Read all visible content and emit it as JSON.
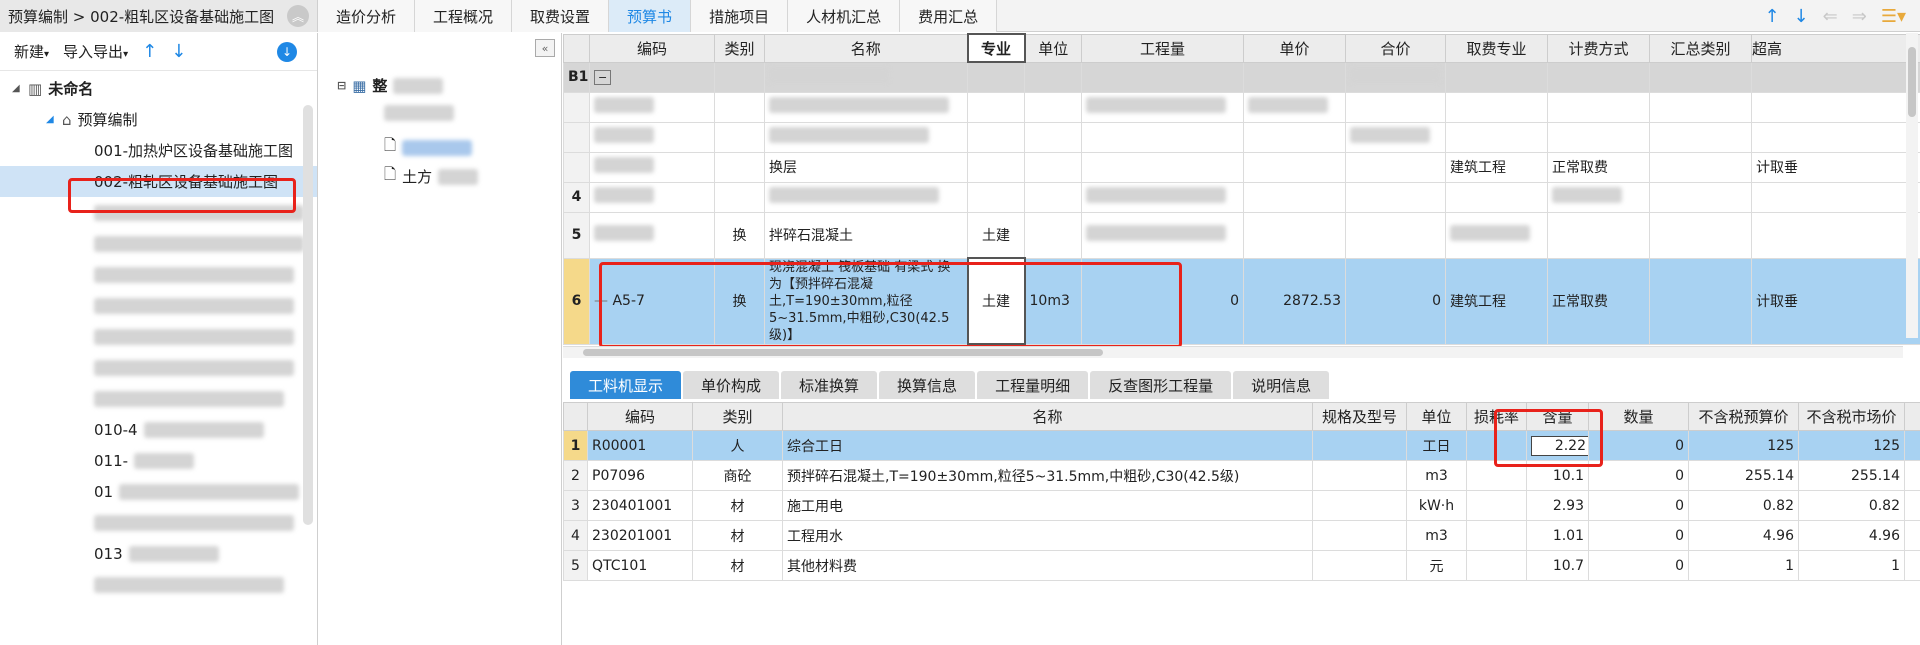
{
  "breadcrumb": "预算编制 > 002-粗轧区设备基础施工图",
  "tabs": [
    {
      "label": "造价分析"
    },
    {
      "label": "工程概况"
    },
    {
      "label": "取费设置"
    },
    {
      "label": "预算书"
    },
    {
      "label": "措施项目"
    },
    {
      "label": "人材机汇总"
    },
    {
      "label": "费用汇总"
    }
  ],
  "active_tab": "预算书",
  "left_toolbar": {
    "new_label": "新建",
    "import_label": "导入导出"
  },
  "tree": {
    "root_label": "未命名",
    "group_label": "预算编制",
    "items": [
      {
        "label": "001-加热炉区设备基础施工图"
      },
      {
        "label": "002-粗轧区设备基础施工图"
      },
      {
        "label": "010-4"
      },
      {
        "label": "011-"
      },
      {
        "label": "01"
      },
      {
        "label": "013"
      }
    ]
  },
  "mid_tree": {
    "root_label": "整",
    "leaf_label": "土方"
  },
  "upper_grid": {
    "columns": [
      "编码",
      "类别",
      "名称",
      "专业",
      "单位",
      "工程量",
      "单价",
      "合价",
      "取费专业",
      "计费方式",
      "汇总类别",
      "超高"
    ],
    "rows": [
      {
        "idx": "B1",
        "code": "",
        "type": "",
        "name": "",
        "spec": "",
        "unit": "",
        "qty": "",
        "price": "",
        "total": "",
        "fee_major": "",
        "fee_mode": "",
        "sum_type": "",
        "extra": ""
      },
      {
        "idx": "",
        "code": "",
        "type": "",
        "name": "",
        "spec": "",
        "unit": "",
        "qty": "",
        "price": "",
        "total": "",
        "fee_major": "",
        "fee_mode": "",
        "sum_type": "",
        "extra": ""
      },
      {
        "idx": "",
        "code": "",
        "type": "",
        "name": "",
        "spec": "",
        "unit": "",
        "qty": "",
        "price": "",
        "total": "",
        "fee_major": "",
        "fee_mode": "",
        "sum_type": "",
        "extra": ""
      },
      {
        "idx": "",
        "code": "",
        "type": "",
        "name": "换层",
        "spec": "",
        "unit": "",
        "qty": "",
        "price": "",
        "total": "",
        "fee_major": "建筑工程",
        "fee_mode": "正常取费",
        "sum_type": "",
        "extra": "计取垂"
      },
      {
        "idx": "4",
        "code": "",
        "type": "",
        "name": "",
        "spec": "",
        "unit": "",
        "qty": "",
        "price": "",
        "total": "",
        "fee_major": "",
        "fee_mode": "",
        "sum_type": "",
        "extra": ""
      },
      {
        "idx": "5",
        "code": "",
        "type": "换",
        "name": "拌碎石混凝土",
        "spec": "土建",
        "unit": "",
        "qty": "",
        "price": "",
        "total": "",
        "fee_major": "",
        "fee_mode": "",
        "sum_type": "",
        "extra": ""
      },
      {
        "idx": "6",
        "code": "A5-7",
        "type": "换",
        "name": "现浇混凝土 筏板基础 有梁式 换为【预拌碎石混凝土,T=190±30mm,粒径5~31.5mm,中粗砂,C30(42.5级)】",
        "spec": "土建",
        "unit": "10m3",
        "qty": "0",
        "price": "2872.53",
        "total": "0",
        "fee_major": "建筑工程",
        "fee_mode": "正常取费",
        "sum_type": "",
        "extra": "计取垂"
      }
    ]
  },
  "lower_tabs": [
    "工料机显示",
    "单价构成",
    "标准换算",
    "换算信息",
    "工程量明细",
    "反查图形工程量",
    "说明信息"
  ],
  "lower_grid": {
    "columns": [
      "编码",
      "类别",
      "名称",
      "规格及型号",
      "单位",
      "损耗率",
      "含量",
      "数量",
      "不含税预算价",
      "不含税市场价"
    ],
    "rows": [
      {
        "idx": "1",
        "code": "R00001",
        "type": "人",
        "name": "综合工日",
        "spec": "",
        "unit": "工日",
        "loss": "",
        "content": "2.22",
        "qty": "0",
        "budget": "125",
        "market": "125"
      },
      {
        "idx": "2",
        "code": "P07096",
        "type": "商砼",
        "name": "预拌碎石混凝土,T=190±30mm,粒径5~31.5mm,中粗砂,C30(42.5级)",
        "spec": "",
        "unit": "m3",
        "loss": "",
        "content": "10.1",
        "qty": "0",
        "budget": "255.14",
        "market": "255.14"
      },
      {
        "idx": "3",
        "code": "230401001",
        "type": "材",
        "name": "施工用电",
        "spec": "",
        "unit": "kW·h",
        "loss": "",
        "content": "2.93",
        "qty": "0",
        "budget": "0.82",
        "market": "0.82"
      },
      {
        "idx": "4",
        "code": "230201001",
        "type": "材",
        "name": "工程用水",
        "spec": "",
        "unit": "m3",
        "loss": "",
        "content": "1.01",
        "qty": "0",
        "budget": "4.96",
        "market": "4.96"
      },
      {
        "idx": "5",
        "code": "QTC101",
        "type": "材",
        "name": "其他材料费",
        "spec": "",
        "unit": "元",
        "loss": "",
        "content": "10.7",
        "qty": "0",
        "budget": "1",
        "market": "1"
      }
    ]
  },
  "colors": {
    "accent": "#1f88e5",
    "selected_row": "#a8d2f2",
    "highlight": "#e8221b"
  }
}
